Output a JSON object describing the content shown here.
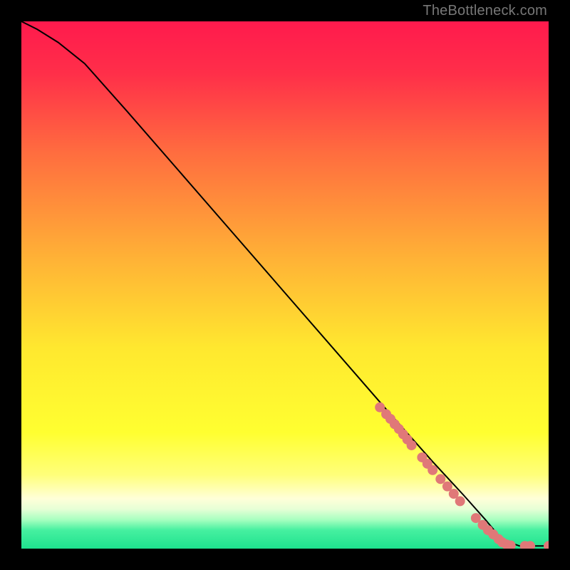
{
  "watermark": "TheBottleneck.com",
  "chart_data": {
    "type": "line",
    "title": "",
    "xlabel": "",
    "ylabel": "",
    "xlim": [
      0,
      1
    ],
    "ylim": [
      0,
      1
    ],
    "background_gradient": {
      "stops": [
        {
          "pos": 0.0,
          "color": "#ff1a4d"
        },
        {
          "pos": 0.1,
          "color": "#ff2f49"
        },
        {
          "pos": 0.25,
          "color": "#ff6d3f"
        },
        {
          "pos": 0.45,
          "color": "#ffb236"
        },
        {
          "pos": 0.62,
          "color": "#ffe82f"
        },
        {
          "pos": 0.78,
          "color": "#ffff30"
        },
        {
          "pos": 0.86,
          "color": "#ffff7a"
        },
        {
          "pos": 0.905,
          "color": "#ffffd8"
        },
        {
          "pos": 0.925,
          "color": "#e6ffd6"
        },
        {
          "pos": 0.945,
          "color": "#a8ffc0"
        },
        {
          "pos": 0.965,
          "color": "#46f0a0"
        },
        {
          "pos": 1.0,
          "color": "#1ee28e"
        }
      ]
    },
    "curve": {
      "x": [
        0.0,
        0.03,
        0.07,
        0.12,
        0.2,
        0.3,
        0.4,
        0.5,
        0.6,
        0.7,
        0.78,
        0.84,
        0.88,
        0.905,
        0.925,
        0.945,
        1.0
      ],
      "y": [
        1.0,
        0.985,
        0.96,
        0.92,
        0.83,
        0.715,
        0.6,
        0.485,
        0.37,
        0.255,
        0.165,
        0.1,
        0.055,
        0.025,
        0.012,
        0.005,
        0.005
      ]
    },
    "markers": {
      "color": "#e07878",
      "radius_px": 7,
      "points": [
        {
          "x": 0.68,
          "y": 0.268
        },
        {
          "x": 0.692,
          "y": 0.255
        },
        {
          "x": 0.7,
          "y": 0.246
        },
        {
          "x": 0.708,
          "y": 0.236
        },
        {
          "x": 0.716,
          "y": 0.227
        },
        {
          "x": 0.724,
          "y": 0.217
        },
        {
          "x": 0.732,
          "y": 0.207
        },
        {
          "x": 0.74,
          "y": 0.196
        },
        {
          "x": 0.76,
          "y": 0.173
        },
        {
          "x": 0.77,
          "y": 0.161
        },
        {
          "x": 0.78,
          "y": 0.149
        },
        {
          "x": 0.795,
          "y": 0.132
        },
        {
          "x": 0.808,
          "y": 0.118
        },
        {
          "x": 0.82,
          "y": 0.104
        },
        {
          "x": 0.832,
          "y": 0.09
        },
        {
          "x": 0.862,
          "y": 0.058
        },
        {
          "x": 0.875,
          "y": 0.045
        },
        {
          "x": 0.885,
          "y": 0.035
        },
        {
          "x": 0.895,
          "y": 0.027
        },
        {
          "x": 0.905,
          "y": 0.018
        },
        {
          "x": 0.912,
          "y": 0.012
        },
        {
          "x": 0.92,
          "y": 0.008
        },
        {
          "x": 0.928,
          "y": 0.006
        },
        {
          "x": 0.955,
          "y": 0.005
        },
        {
          "x": 0.965,
          "y": 0.005
        },
        {
          "x": 1.0,
          "y": 0.005
        }
      ]
    }
  }
}
